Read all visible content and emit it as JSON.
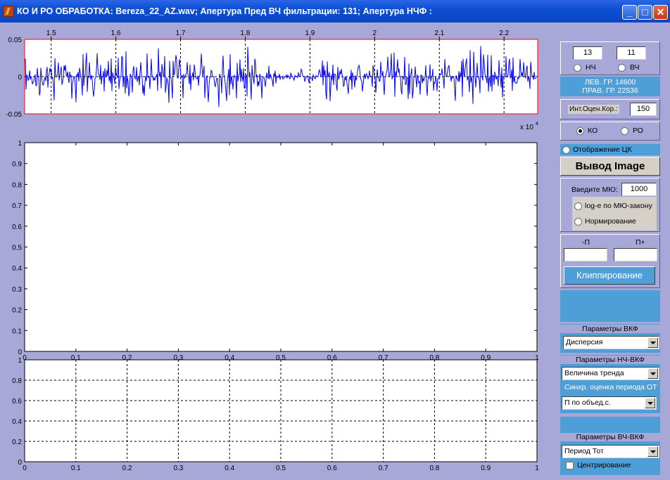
{
  "window": {
    "title": "КО И РО ОБРАБОТКА: Bereza_22_AZ.wav;  Апертура Пред ВЧ фильтрации: 131;  Апертура НЧФ :",
    "minimize": "_",
    "maximize": "□",
    "close": "✕"
  },
  "plot1": {
    "xticks": [
      "1.5",
      "1.6",
      "1.7",
      "1.8",
      "1.9",
      "2",
      "2.1",
      "2.2"
    ],
    "yticks": [
      "0.05",
      "0",
      "-0.05"
    ],
    "exponent_base": "x 10",
    "exponent_power": "4",
    "signal_color": "#0000ff",
    "border_color": "#ff0000"
  },
  "plot2": {
    "xticks": [
      "0",
      "0.1",
      "0.2",
      "0.3",
      "0.4",
      "0.5",
      "0.6",
      "0.7",
      "0.8",
      "0.9",
      "1"
    ],
    "yticks": [
      "0",
      "0.1",
      "0.2",
      "0.3",
      "0.4",
      "0.5",
      "0.6",
      "0.7",
      "0.8",
      "0.9",
      "1"
    ]
  },
  "plot3": {
    "xticks": [
      "0",
      "0.1",
      "0.2",
      "0.3",
      "0.4",
      "0.5",
      "0.6",
      "0.7",
      "0.8",
      "0.9",
      "1"
    ],
    "yticks": [
      "0",
      "0.2",
      "0.4",
      "0.6",
      "0.8",
      "1"
    ]
  },
  "controls": {
    "lf_value": "13",
    "hf_value": "11",
    "lf_label": "НЧ",
    "hf_label": "ВЧ",
    "left_bound": "ЛЕВ. ГР.  14600",
    "right_bound": "ПРАВ. ГР. 22536",
    "int_label": "Инт.Оцен.Кор.:",
    "int_value": "150",
    "ko_label": "КО",
    "ro_label": "РО",
    "show_ck": "Отображение ЦК",
    "output_image": "Вывод Image",
    "mu_label": "Введите МЮ:",
    "mu_value": "1000",
    "log_mu": "log-е по МЮ-закону",
    "normalize": "Нормирование",
    "minus_p": "-П",
    "plus_p": "П+",
    "minus_p_value": "",
    "plus_p_value": "",
    "clip": "Клиппирование",
    "vkf_params": "Параметры ВКФ",
    "vkf_select": "Дисперсия",
    "lf_vkf_params": "Параметры НЧ-ВКФ",
    "lf_vkf_select": "Величина тренда",
    "sync_label": "Синхр. оценка периода ОТ",
    "sync_select": "П по объед.с.",
    "hf_vkf_params": "Параметры ВЧ-ВКФ",
    "hf_vkf_select": "Период Тот",
    "centering": "Центрирование",
    "accent_blue": "#4e9ed8",
    "bg_lavender": "#a7a8d8"
  }
}
